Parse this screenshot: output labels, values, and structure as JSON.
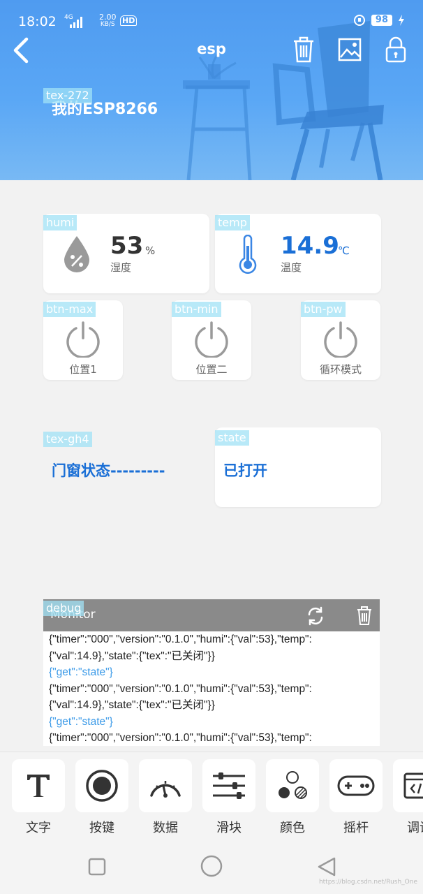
{
  "status_bar": {
    "time": "18:02",
    "network": "4G",
    "speed_value": "2.00",
    "speed_unit": "KB/S",
    "hd": "HD",
    "battery": "98"
  },
  "header": {
    "title": "esp",
    "device_name": "我的ESP8266",
    "device_tag": "tex-272"
  },
  "widgets": {
    "humi": {
      "tag": "humi",
      "value": "53",
      "unit": "%",
      "label": "湿度"
    },
    "temp": {
      "tag": "temp",
      "value": "14.9",
      "unit": "℃",
      "label": "温度"
    },
    "btn_max": {
      "tag": "btn-max",
      "label": "位置1"
    },
    "btn_min": {
      "tag": "btn-min",
      "label": "位置二"
    },
    "btn_pw": {
      "tag": "btn-pw",
      "label": "循环模式"
    },
    "door_text": {
      "tag": "tex-gh4",
      "text": "门窗状态---------"
    },
    "state": {
      "tag": "state",
      "text": "已打开"
    }
  },
  "monitor": {
    "tag": "debug",
    "title": "Monitor",
    "lines": [
      {
        "text": "{\"timer\":\"000\",\"version\":\"0.1.0\",\"humi\":{\"val\":53},\"temp\":",
        "type": "recv"
      },
      {
        "text": "{\"val\":14.9},\"state\":{\"tex\":\"已关闭\"}}",
        "type": "recv"
      },
      {
        "text": "{\"get\":\"state\"}",
        "type": "get"
      },
      {
        "text": "{\"timer\":\"000\",\"version\":\"0.1.0\",\"humi\":{\"val\":53},\"temp\":",
        "type": "recv"
      },
      {
        "text": "{\"val\":14.9},\"state\":{\"tex\":\"已关闭\"}}",
        "type": "recv"
      },
      {
        "text": "{\"get\":\"state\"}",
        "type": "get"
      },
      {
        "text": "{\"timer\":\"000\",\"version\":\"0.1.0\",\"humi\":{\"val\":53},\"temp\":",
        "type": "recv"
      }
    ]
  },
  "toolbar": {
    "items": [
      {
        "label": "文字",
        "icon": "text-icon"
      },
      {
        "label": "按键",
        "icon": "button-icon"
      },
      {
        "label": "数据",
        "icon": "gauge-icon"
      },
      {
        "label": "滑块",
        "icon": "slider-icon"
      },
      {
        "label": "颜色",
        "icon": "color-icon"
      },
      {
        "label": "摇杆",
        "icon": "joystick-icon"
      },
      {
        "label": "调试",
        "icon": "debug-icon"
      }
    ]
  },
  "watermark": "https://blog.csdn.net/Rush_One",
  "colors": {
    "header": "#4f9bf0",
    "accent_blue": "#1a6fd6",
    "tag_bg": "#a0e1f5",
    "monitor_header": "#8a8a8a"
  }
}
